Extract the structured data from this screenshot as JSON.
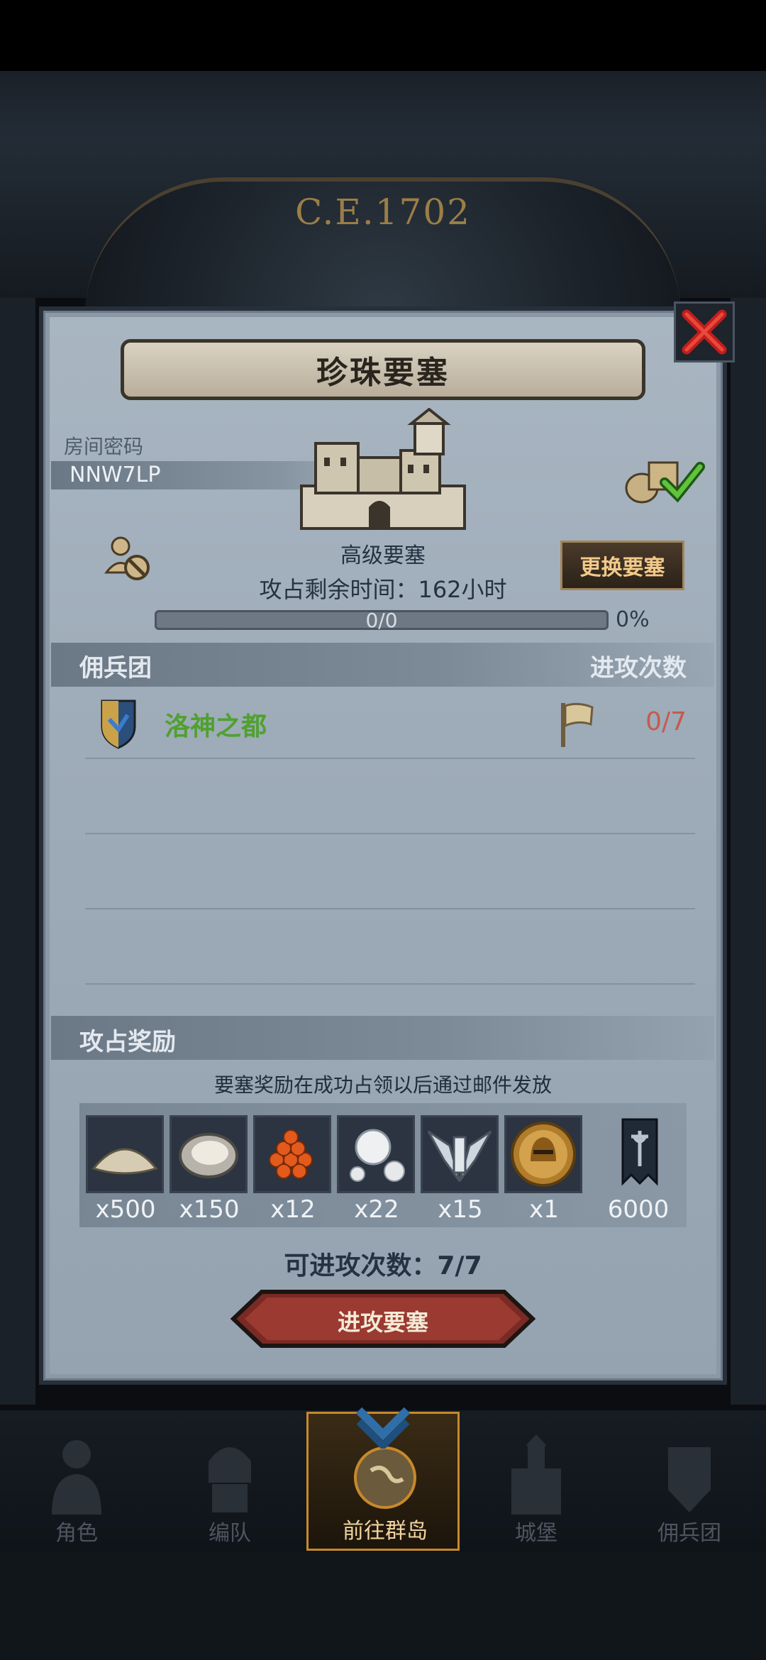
{
  "header": {
    "year_text": "C.E.1702"
  },
  "panel": {
    "title": "珍珠要塞",
    "room_label": "房间密码",
    "room_code": "NNW7LP",
    "fortress_level": "高级要塞",
    "change_button": "更换要塞",
    "time_remaining": "攻占剩余时间：162小时",
    "progress": {
      "count": "0/0",
      "percent_text": "0%",
      "fraction": 0
    }
  },
  "mercenaries": {
    "title": "佣兵团",
    "attacks_header": "进攻次数",
    "rows": [
      {
        "name": "洛神之都",
        "attacks": "0/7"
      }
    ]
  },
  "rewards": {
    "title": "攻占奖励",
    "note": "要塞奖励在成功占领以后通过邮件发放",
    "items": [
      {
        "icon": "sand-pile-icon",
        "qty": "x500"
      },
      {
        "icon": "oyster-icon",
        "qty": "x150"
      },
      {
        "icon": "roe-icon",
        "qty": "x12"
      },
      {
        "icon": "pearl-icon",
        "qty": "x22"
      },
      {
        "icon": "silver-wings-icon",
        "qty": "x15"
      },
      {
        "icon": "knight-helmet-coin-icon",
        "qty": "x1"
      },
      {
        "icon": "war-banner-icon",
        "qty": "6000"
      }
    ]
  },
  "attacks_left": "可进攻次数：7/7",
  "attack_button": "进攻要塞",
  "nav": {
    "items": [
      {
        "label": "角色",
        "icon": "character-icon",
        "active": false
      },
      {
        "label": "编队",
        "icon": "formation-icon",
        "active": false
      },
      {
        "label": "前往群岛",
        "icon": "archipelago-icon",
        "active": true
      },
      {
        "label": "城堡",
        "icon": "castle-icon",
        "active": false
      },
      {
        "label": "佣兵团",
        "icon": "mercenary-icon",
        "active": false
      }
    ]
  },
  "colors": {
    "accent_gold": "#c7892b",
    "guild_green": "#4fa12f",
    "attack_red": "#c55a4f"
  }
}
